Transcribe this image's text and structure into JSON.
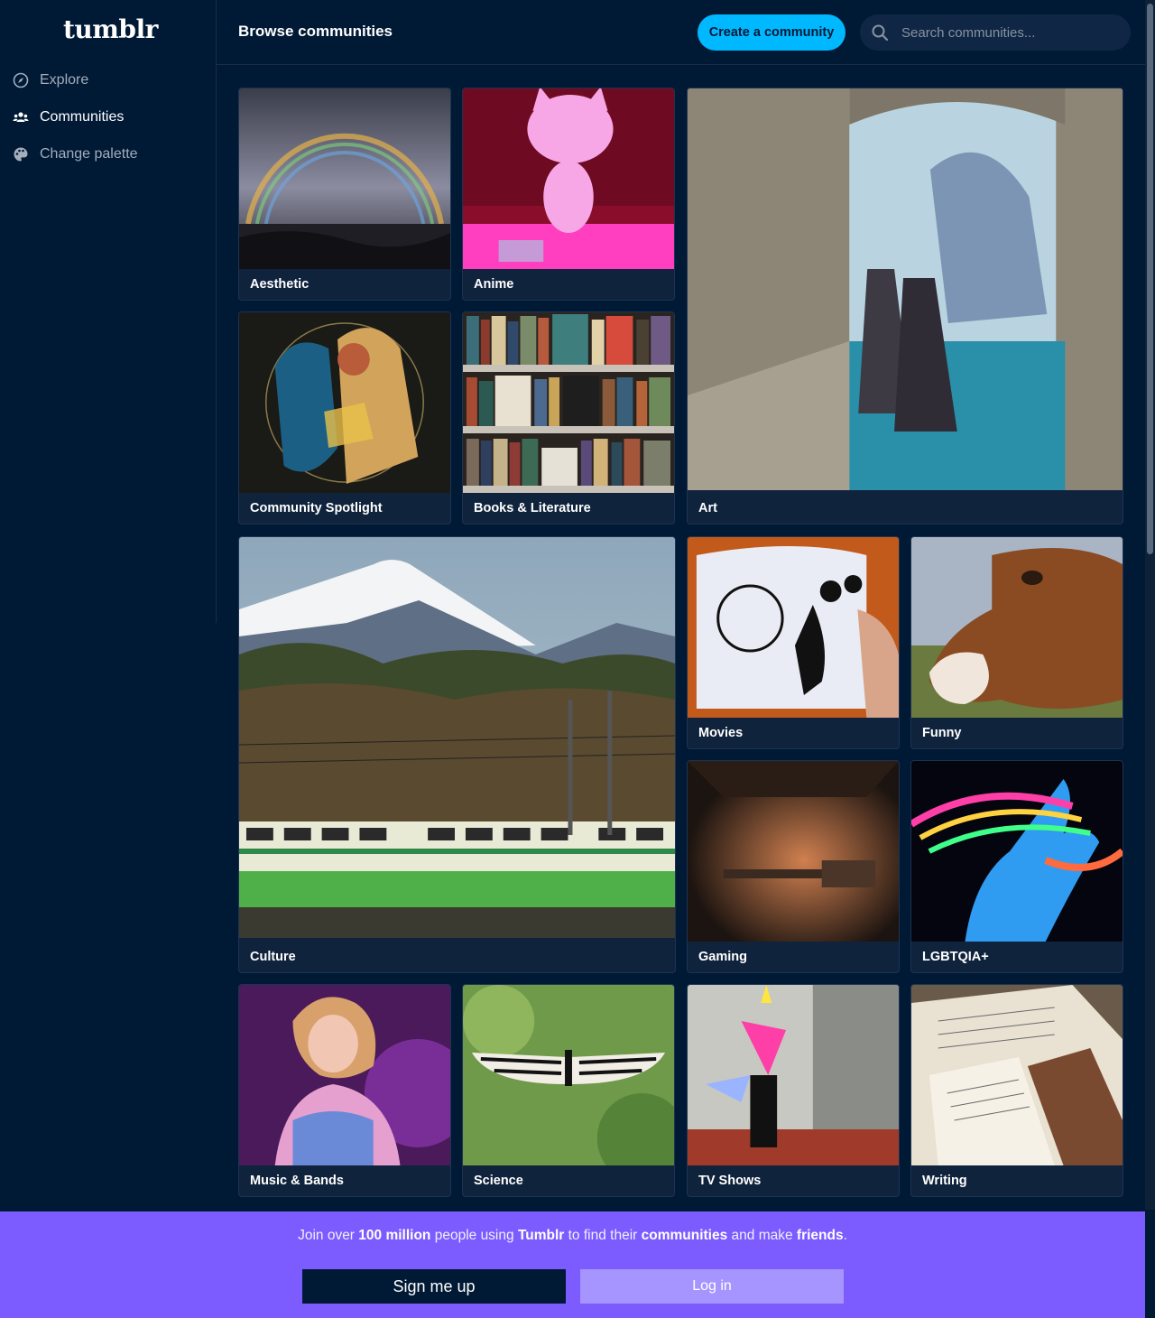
{
  "sidebar": {
    "logo": "tumblr",
    "items": [
      {
        "label": "Explore",
        "icon": "compass-icon",
        "active": false
      },
      {
        "label": "Communities",
        "icon": "people-icon",
        "active": true
      },
      {
        "label": "Change palette",
        "icon": "palette-icon",
        "active": false
      }
    ]
  },
  "header": {
    "title": "Browse communities",
    "create_label": "Create a community",
    "search_placeholder": "Search communities..."
  },
  "communities": [
    {
      "label": "Aesthetic"
    },
    {
      "label": "Anime"
    },
    {
      "label": "Art"
    },
    {
      "label": "Community Spotlight"
    },
    {
      "label": "Books & Literature"
    },
    {
      "label": "Culture"
    },
    {
      "label": "Movies"
    },
    {
      "label": "Funny"
    },
    {
      "label": "Gaming"
    },
    {
      "label": "LGBTQIA+"
    },
    {
      "label": "Music & Bands"
    },
    {
      "label": "Science"
    },
    {
      "label": "TV Shows"
    },
    {
      "label": "Writing"
    }
  ],
  "banner": {
    "text_1": "Join over ",
    "text_2": "100 million",
    "text_3": " people using ",
    "text_4": "Tumblr",
    "text_5": " to find their ",
    "text_6": "communities",
    "text_7": " and make ",
    "text_8": "friends",
    "text_9": ".",
    "signup_label": "Sign me up",
    "login_label": "Log in"
  },
  "colors": {
    "background": "#001935",
    "accent": "#00b8ff",
    "banner": "#7c5cff",
    "card": "#10233d"
  }
}
